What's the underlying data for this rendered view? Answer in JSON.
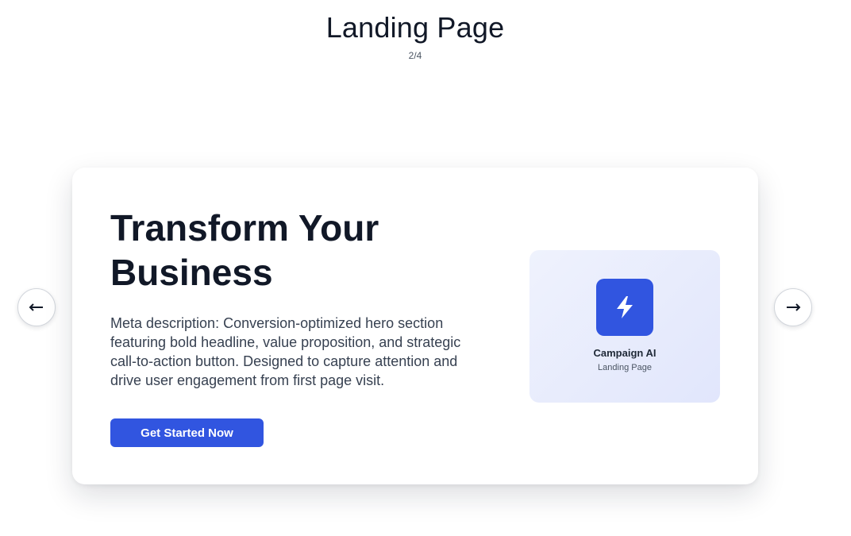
{
  "header": {
    "title": "Landing Page",
    "counter": "2/4"
  },
  "slide": {
    "headline": "Transform Your Business",
    "description": "Meta description: Conversion-optimized hero section featuring bold headline, value proposition, and strategic call-to-action button. Designed to capture attention and drive user engagement from first page visit.",
    "cta_label": "Get Started Now",
    "preview": {
      "icon": "lightning-bolt-icon",
      "title": "Campaign AI",
      "subtitle": "Landing Page"
    }
  },
  "navigation": {
    "prev_icon": "arrow-left-icon",
    "next_icon": "arrow-right-icon"
  },
  "colors": {
    "accent": "#3155e0",
    "text_primary": "#111827",
    "text_secondary": "#374151",
    "preview_bg": "#e8ecfc"
  }
}
